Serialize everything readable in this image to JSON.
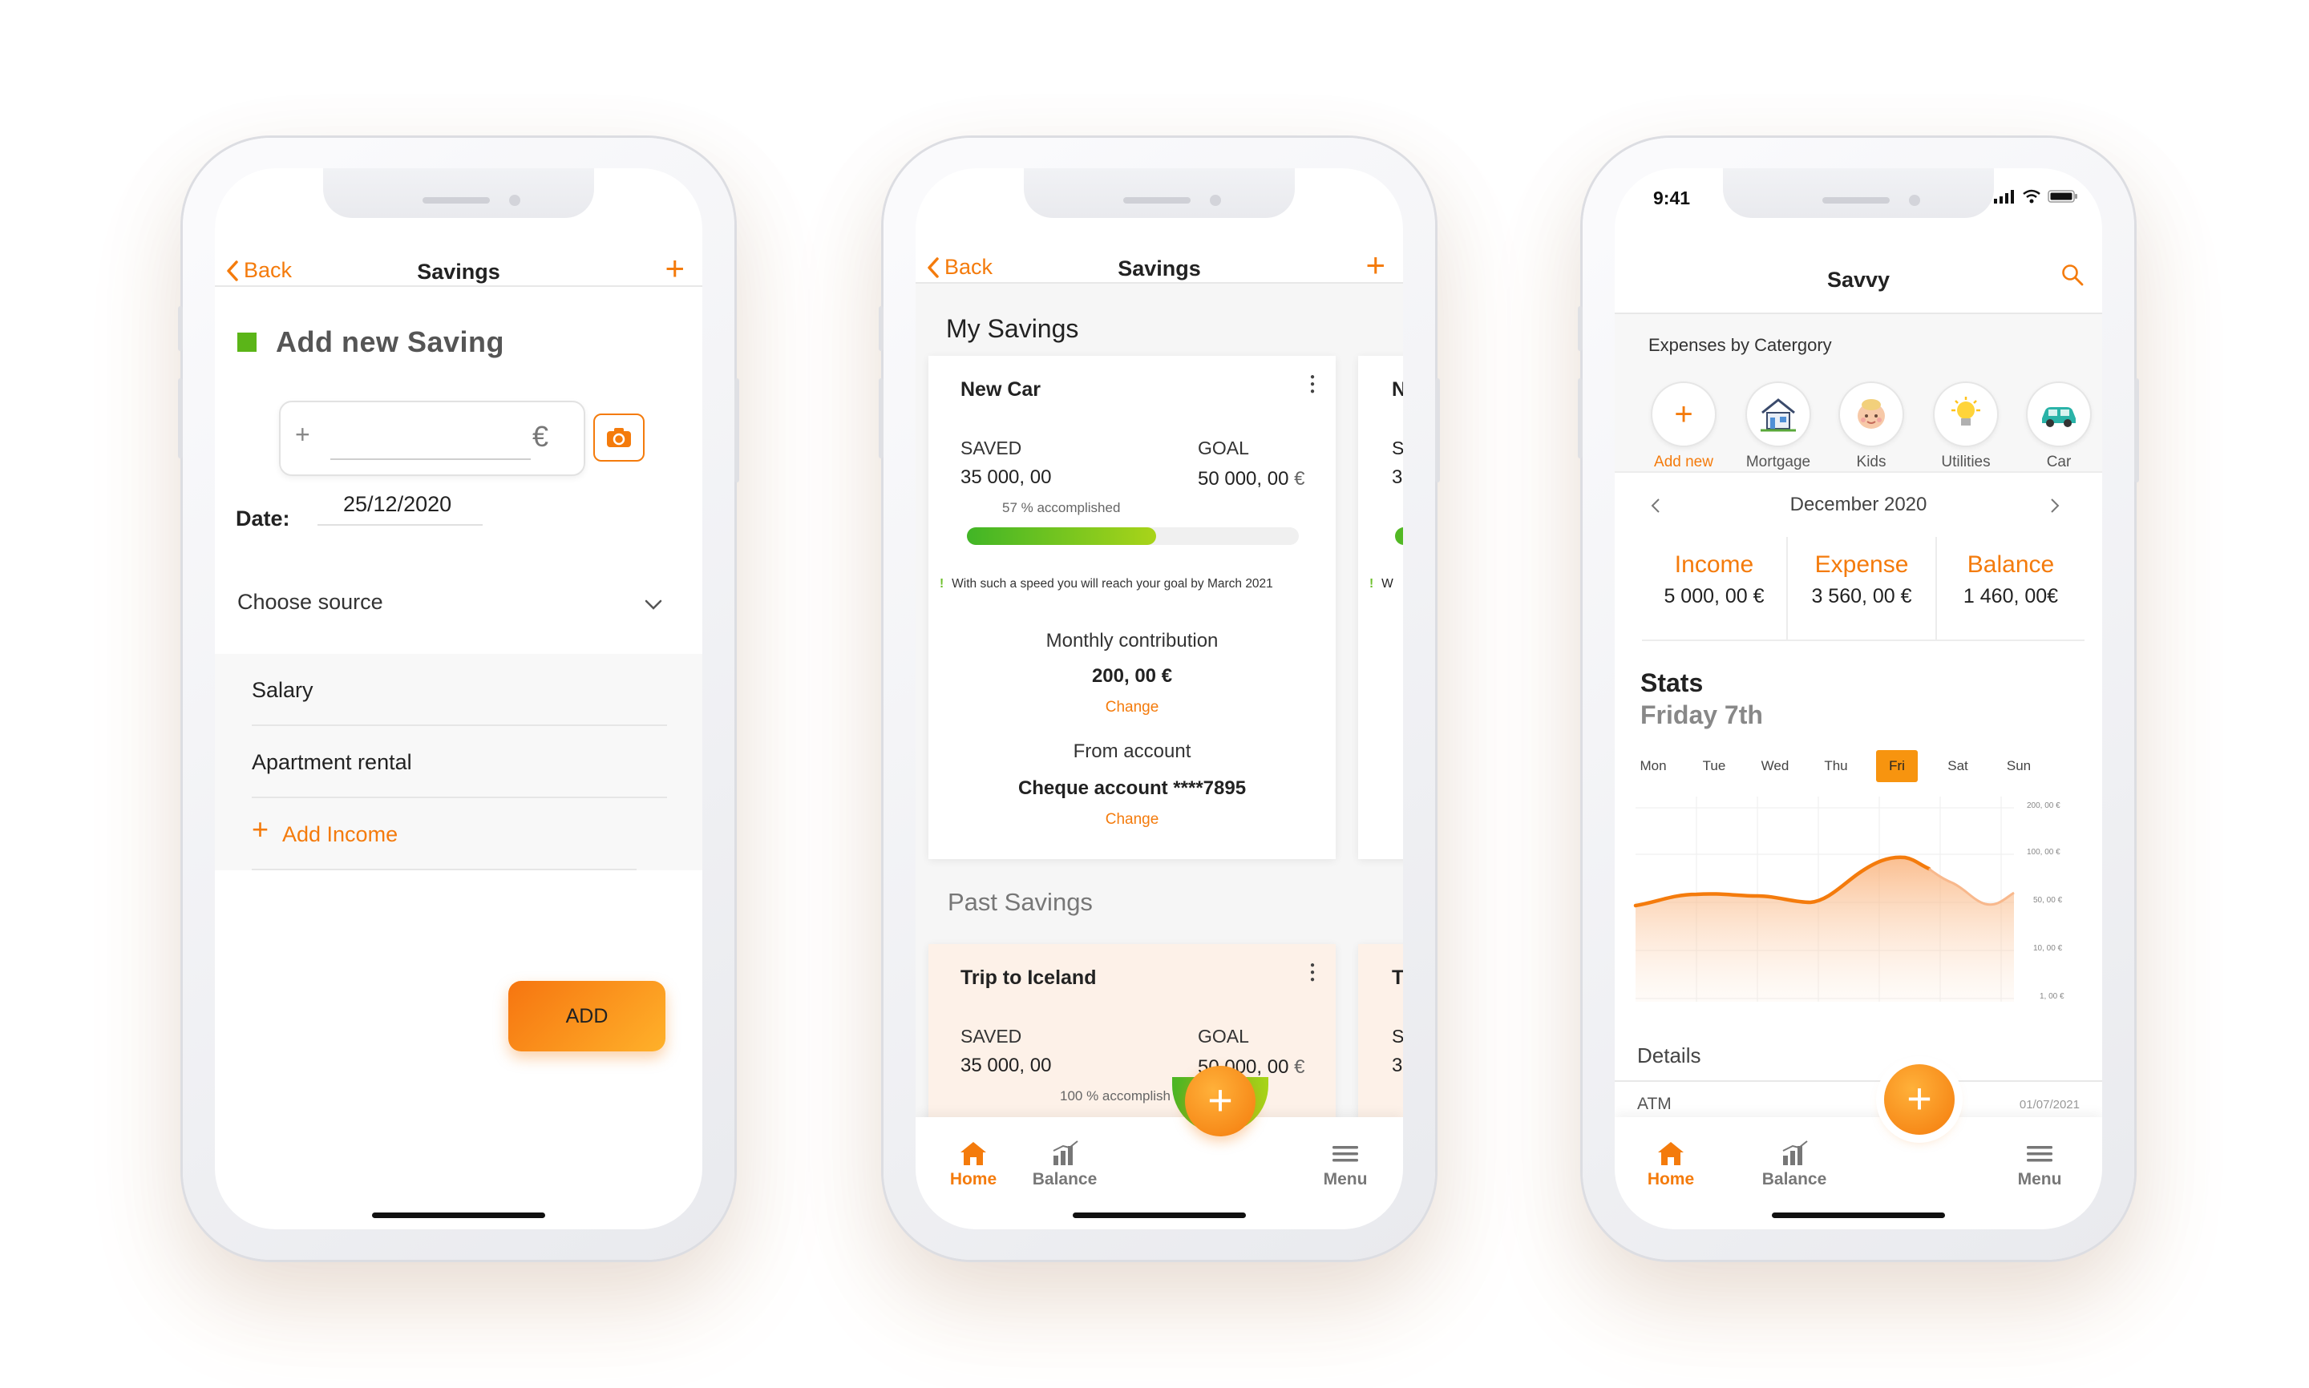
{
  "brand_color": "#f47b0c",
  "phone1": {
    "nav": {
      "back": "Back",
      "title": "Savings",
      "plus": "+"
    },
    "heading": "Add new Saving",
    "amount": {
      "prefix": "+",
      "value": "",
      "currency": "€",
      "camera_icon": "camera-icon"
    },
    "date": {
      "label": "Date:",
      "value": "25/12/2020"
    },
    "source": {
      "label": "Choose source",
      "options": [
        "Salary",
        "Apartment rental"
      ],
      "add_label": "Add Income"
    },
    "add_button": "ADD"
  },
  "phone2": {
    "nav": {
      "back": "Back",
      "title": "Savings",
      "plus": "+"
    },
    "section_title": "My Savings",
    "current": {
      "name": "New Car",
      "saved_label": "SAVED",
      "saved_value": "35 000, 00",
      "goal_label": "GOAL",
      "goal_value": "50 000, 00",
      "goal_currency": "€",
      "progress": 57,
      "progress_text": "57 %  accomplished",
      "note": "With such a speed you will reach your goal by March 2021",
      "monthly_label": "Monthly contribution",
      "monthly_value": "200, 00 €",
      "change1": "Change",
      "account_label": "From account",
      "account_value": "Cheque account ****7895",
      "change2": "Change"
    },
    "peek": {
      "title": "N",
      "saved_label": "S",
      "saved_value": "3",
      "note": "W"
    },
    "past_title": "Past Savings",
    "past": {
      "name": "Trip to Iceland",
      "saved_label": "SAVED",
      "saved_value": "35 000, 00",
      "goal_label": "GOAL",
      "goal_value": "50 000, 00",
      "goal_currency": "€",
      "progress_text": "100 %  accomplish"
    },
    "past_peek": {
      "title": "T",
      "saved_label": "S",
      "saved_value": "3"
    },
    "tabs": {
      "home": "Home",
      "balance": "Balance",
      "menu": "Menu"
    }
  },
  "phone3": {
    "status": {
      "time": "9:41"
    },
    "title": "Savvy",
    "categories_title": "Expenses by Catergory",
    "categories": [
      {
        "label": "Add new",
        "icon": "plus-icon"
      },
      {
        "label": "Mortgage",
        "icon": "house-icon"
      },
      {
        "label": "Kids",
        "icon": "baby-icon"
      },
      {
        "label": "Utilities",
        "icon": "lightbulb-icon"
      },
      {
        "label": "Car",
        "icon": "car-icon"
      }
    ],
    "month": "December 2020",
    "summary": [
      {
        "label": "Income",
        "value": "5 000, 00 €"
      },
      {
        "label": "Expense",
        "value": "3 560, 00 €"
      },
      {
        "label": "Balance",
        "value": "1 460, 00€"
      }
    ],
    "stats_title": "Stats",
    "stats_subtitle": "Friday 7th",
    "days": [
      "Mon",
      "Tue",
      "Wed",
      "Thu",
      "Fri",
      "Sat",
      "Sun"
    ],
    "selected_day": "Fri",
    "chart_ticks": [
      "200, 00 €",
      "100, 00 €",
      "50, 00 €",
      "10, 00 €",
      "1, 00 €"
    ],
    "details_title": "Details",
    "detail_row": {
      "name": "ATM",
      "date": "01/07/2021"
    },
    "tabs": {
      "home": "Home",
      "balance": "Balance",
      "menu": "Menu"
    }
  }
}
